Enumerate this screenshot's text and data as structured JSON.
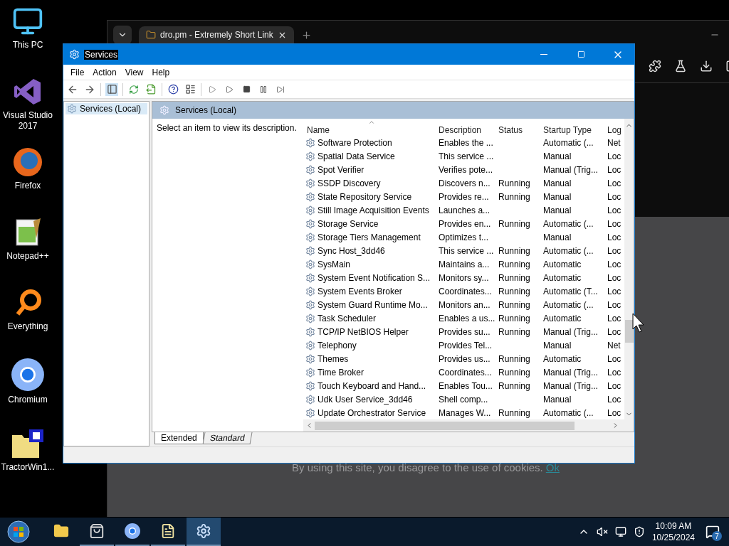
{
  "desktop_icons": [
    {
      "kind": "computer",
      "label": "This PC"
    },
    {
      "kind": "studio",
      "label": "Visual Studio 2017"
    },
    {
      "kind": "firefox",
      "label": "Firefox"
    },
    {
      "kind": "notepad",
      "label": "Notepad++"
    },
    {
      "kind": "everything",
      "label": "Everything"
    },
    {
      "kind": "chromium",
      "label": "Chromium"
    },
    {
      "kind": "archive",
      "label": "TractorWin1..."
    }
  ],
  "browser": {
    "tab_title": "dro.pm - Extremely Short Link",
    "cookie_notice": {
      "text": "By using this site, you disagree to the use of cookies.",
      "link": "Ok"
    }
  },
  "services_window": {
    "title": "Services",
    "title_highlighted": true,
    "menu": [
      "File",
      "Action",
      "View",
      "Help"
    ],
    "tree": [
      {
        "label": "Services (Local)",
        "selected": true
      }
    ],
    "panel_title": "Services (Local)",
    "description_hint": "Select an item to view its description.",
    "columns": [
      {
        "label": "Name",
        "sorted": true
      },
      {
        "label": "Description",
        "sorted": false
      },
      {
        "label": "Status",
        "sorted": false
      },
      {
        "label": "Startup Type",
        "sorted": false
      },
      {
        "label": "Log",
        "sorted": false
      }
    ],
    "rows": [
      {
        "name": "Software Protection",
        "description": "Enables the ...",
        "startup_type": "Automatic (...",
        "log_on": "Net"
      },
      {
        "name": "Spatial Data Service",
        "description": "This service ...",
        "startup_type": "Manual",
        "log_on": "Loc"
      },
      {
        "name": "Spot Verifier",
        "description": "Verifies pote...",
        "startup_type": "Manual (Trig...",
        "log_on": "Loc"
      },
      {
        "name": "SSDP Discovery",
        "description": "Discovers n...",
        "status": "Running",
        "startup_type": "Manual",
        "log_on": "Loc"
      },
      {
        "name": "State Repository Service",
        "description": "Provides re...",
        "status": "Running",
        "startup_type": "Manual",
        "log_on": "Loc"
      },
      {
        "name": "Still Image Acquisition Events",
        "description": "Launches a...",
        "startup_type": "Manual",
        "log_on": "Loc"
      },
      {
        "name": "Storage Service",
        "description": "Provides en...",
        "status": "Running",
        "startup_type": "Automatic (...",
        "log_on": "Loc"
      },
      {
        "name": "Storage Tiers Management",
        "description": "Optimizes t...",
        "startup_type": "Manual",
        "log_on": "Loc"
      },
      {
        "name": "Sync Host_3dd46",
        "description": "This service ...",
        "status": "Running",
        "startup_type": "Automatic (...",
        "log_on": "Loc"
      },
      {
        "name": "SysMain",
        "description": "Maintains a...",
        "status": "Running",
        "startup_type": "Automatic",
        "log_on": "Loc"
      },
      {
        "name": "System Event Notification S...",
        "description": "Monitors sy...",
        "status": "Running",
        "startup_type": "Automatic",
        "log_on": "Loc"
      },
      {
        "name": "System Events Broker",
        "description": "Coordinates...",
        "status": "Running",
        "startup_type": "Automatic (T...",
        "log_on": "Loc"
      },
      {
        "name": "System Guard Runtime Mo...",
        "description": "Monitors an...",
        "status": "Running",
        "startup_type": "Automatic (...",
        "log_on": "Loc"
      },
      {
        "name": "Task Scheduler",
        "description": "Enables a us...",
        "status": "Running",
        "startup_type": "Automatic",
        "log_on": "Loc"
      },
      {
        "name": "TCP/IP NetBIOS Helper",
        "description": "Provides su...",
        "status": "Running",
        "startup_type": "Manual (Trig...",
        "log_on": "Loc"
      },
      {
        "name": "Telephony",
        "description": "Provides Tel...",
        "startup_type": "Manual",
        "log_on": "Net"
      },
      {
        "name": "Themes",
        "description": "Provides us...",
        "status": "Running",
        "startup_type": "Automatic",
        "log_on": "Loc"
      },
      {
        "name": "Time Broker",
        "description": "Coordinates...",
        "status": "Running",
        "startup_type": "Manual (Trig...",
        "log_on": "Loc"
      },
      {
        "name": "Touch Keyboard and Hand...",
        "description": "Enables Tou...",
        "status": "Running",
        "startup_type": "Manual (Trig...",
        "log_on": "Loc"
      },
      {
        "name": "Udk User Service_3dd46",
        "description": "Shell comp...",
        "startup_type": "Manual",
        "log_on": "Loc"
      },
      {
        "name": "Update Orchestrator Service",
        "description": "Manages W...",
        "status": "Running",
        "startup_type": "Automatic (...",
        "log_on": "Loc"
      }
    ],
    "view_tabs": [
      {
        "label": "Extended",
        "selected": true
      },
      {
        "label": "Standard",
        "selected": false
      }
    ]
  },
  "taskbar": {
    "apps": [
      {
        "kind": "explorer",
        "active": false,
        "running": false
      },
      {
        "kind": "store",
        "active": false,
        "running": true
      },
      {
        "kind": "chromium",
        "active": false,
        "running": true
      },
      {
        "kind": "notepad",
        "active": false,
        "running": true
      },
      {
        "kind": "services",
        "active": true,
        "running": true
      }
    ],
    "time": "10:09 AM",
    "date": "10/25/2024",
    "notification_count": "7"
  }
}
